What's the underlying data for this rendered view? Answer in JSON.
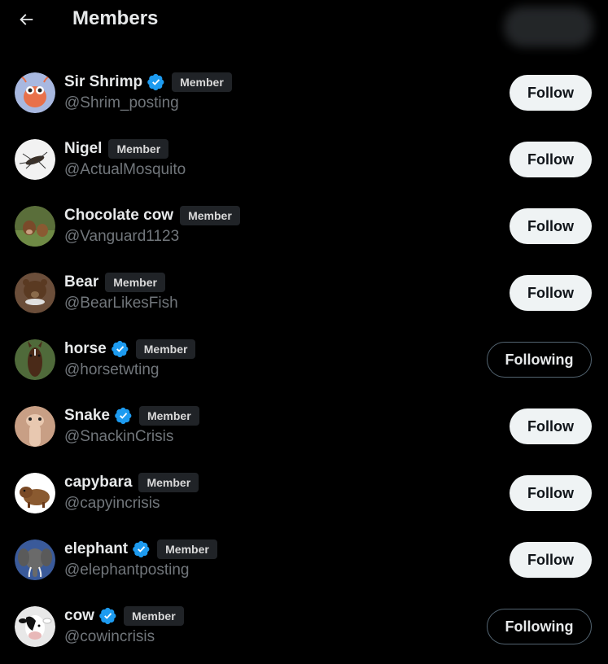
{
  "header": {
    "title": "Members"
  },
  "members": [
    {
      "name": "Sir Shrimp",
      "handle": "@Shrim_posting",
      "verified": true,
      "badge": "Member",
      "button": "Follow",
      "following": false,
      "avatar_icon": "shrimp-avatar-icon",
      "avatar_bg": "#a8b8e0"
    },
    {
      "name": "Nigel",
      "handle": "@ActualMosquito",
      "verified": false,
      "badge": "Member",
      "button": "Follow",
      "following": false,
      "avatar_icon": "mosquito-avatar-icon",
      "avatar_bg": "#f2f2f2"
    },
    {
      "name": "Chocolate cow",
      "handle": "@Vanguard1123",
      "verified": false,
      "badge": "Member",
      "button": "Follow",
      "following": false,
      "avatar_icon": "cow-avatar-icon",
      "avatar_bg": "#5a6e3a"
    },
    {
      "name": "Bear",
      "handle": "@BearLikesFish",
      "verified": false,
      "badge": "Member",
      "button": "Follow",
      "following": false,
      "avatar_icon": "bear-avatar-icon",
      "avatar_bg": "#6b4e3a"
    },
    {
      "name": "horse",
      "handle": "@horsetwting",
      "verified": true,
      "badge": "Member",
      "button": "Following",
      "following": true,
      "avatar_icon": "horse-avatar-icon",
      "avatar_bg": "#4f6a3a"
    },
    {
      "name": "Snake",
      "handle": "@SnackinCrisis",
      "verified": true,
      "badge": "Member",
      "button": "Follow",
      "following": false,
      "avatar_icon": "snake-avatar-icon",
      "avatar_bg": "#c89f85"
    },
    {
      "name": "capybara",
      "handle": "@capyincrisis",
      "verified": false,
      "badge": "Member",
      "button": "Follow",
      "following": false,
      "avatar_icon": "capybara-avatar-icon",
      "avatar_bg": "#ffffff"
    },
    {
      "name": "elephant",
      "handle": "@elephantposting",
      "verified": true,
      "badge": "Member",
      "button": "Follow",
      "following": false,
      "avatar_icon": "elephant-avatar-icon",
      "avatar_bg": "#3a5a9a"
    },
    {
      "name": "cow",
      "handle": "@cowincrisis",
      "verified": true,
      "badge": "Member",
      "button": "Following",
      "following": true,
      "avatar_icon": "cow-bw-avatar-icon",
      "avatar_bg": "#e8e8e8"
    }
  ],
  "colors": {
    "verified": "#1d9bf0",
    "background": "#000000",
    "follow_bg": "#eff3f4"
  }
}
